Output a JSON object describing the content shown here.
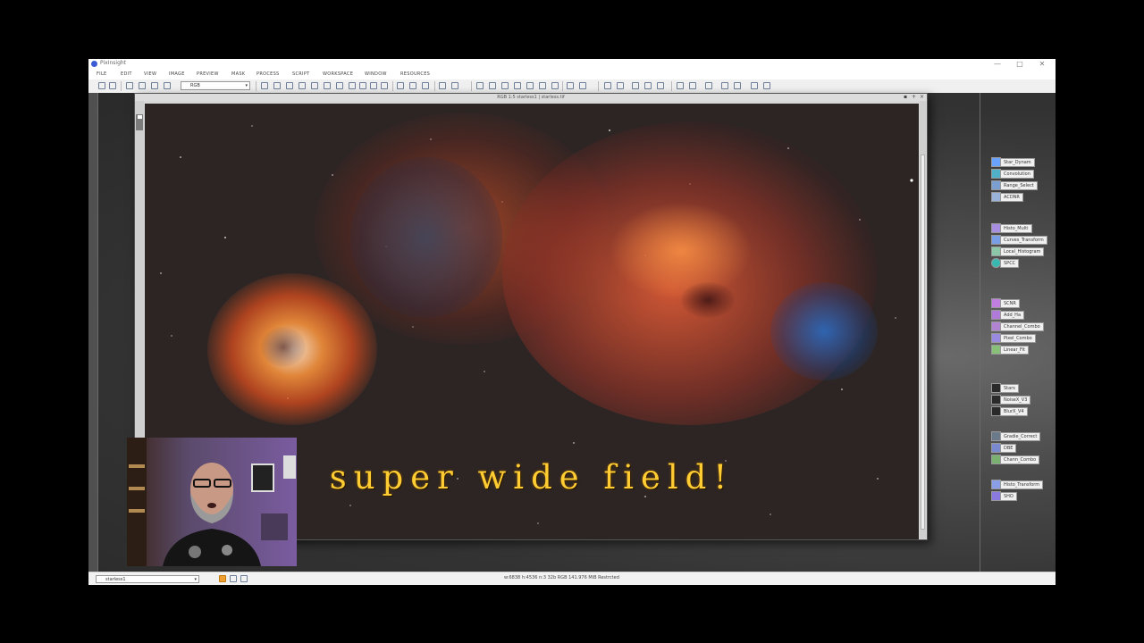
{
  "app": {
    "title": "PixInsight",
    "window_controls": {
      "minimize": "—",
      "maximize": "□",
      "close": "✕"
    }
  },
  "menu": [
    "FILE",
    "EDIT",
    "VIEW",
    "IMAGE",
    "PREVIEW",
    "MASK",
    "PROCESS",
    "SCRIPT",
    "WORKSPACE",
    "WINDOW",
    "RESOURCES"
  ],
  "toolbar": {
    "channel_select": "RGB",
    "dropdown_arrow": "▾"
  },
  "image_window": {
    "title": "RGB 1:5 starless1 | starless.tif",
    "side_tab": "starless1",
    "buttons": {
      "shade": "▪",
      "maximize": "+",
      "close": "×"
    }
  },
  "overlay_text": "super wide field!",
  "process_shortcuts": [
    {
      "label": "Star_Dynam",
      "color": "#6aa3ff"
    },
    {
      "label": "Convolution",
      "color": "#4fb0c8"
    },
    {
      "label": "Range_Select",
      "color": "#7b9fd0"
    },
    {
      "label": "ACDNR",
      "color": "#9ab3d8"
    },
    {
      "label": "Histo_Multi",
      "color": "#a88ee0"
    },
    {
      "label": "Curves_Transform",
      "color": "#7a9ee6"
    },
    {
      "label": "Local_Histogram",
      "color": "#8cc7a8"
    },
    {
      "label": "SPCC",
      "color": "#38b8b0"
    },
    {
      "label": "SCNR",
      "color": "#c07ee0"
    },
    {
      "label": "Add_Ha",
      "color": "#b07ad8"
    },
    {
      "label": "Channel_Combo",
      "color": "#b084d0"
    },
    {
      "label": "Pixel_Combo",
      "color": "#9a8be0"
    },
    {
      "label": "Linear_Fit",
      "color": "#88c07a"
    },
    {
      "label": "Stars",
      "color": "#2a2a2a"
    },
    {
      "label": "NoiseX_V3",
      "color": "#2a2a2a"
    },
    {
      "label": "BlurX_V4",
      "color": "#2a2a2a"
    },
    {
      "label": "Gradie_Correct",
      "color": "#6a7a8a"
    },
    {
      "label": "DBE",
      "color": "#7a8ad0"
    },
    {
      "label": "Chann_Combo",
      "color": "#7ab070"
    },
    {
      "label": "Histo_Transform",
      "color": "#8a9ee8"
    },
    {
      "label": "SHO",
      "color": "#8a7ae0"
    }
  ],
  "status": {
    "view": "starless1",
    "info": "w:6838   h:4536   n:3   32b   RGB   141.976 MiB   Restrcted"
  }
}
